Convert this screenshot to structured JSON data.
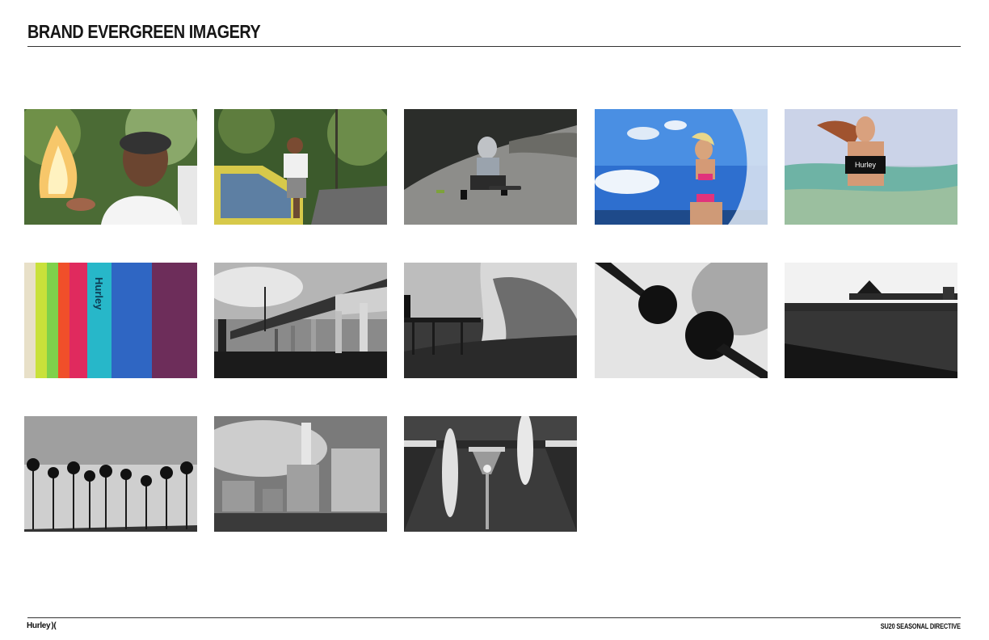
{
  "header": {
    "title": "BRAND EVERGREEN IMAGERY"
  },
  "footer": {
    "brand": "Hurley",
    "brand_mark_glyph": ")(",
    "right_text": "SU20 SEASONAL DIRECTIVE"
  },
  "gallery": {
    "photo_text": {
      "swimwear_logo": "Hurley",
      "board_logo": "Hurley"
    },
    "images": [
      {
        "name": "photo-man-fire-trees",
        "tone": "color"
      },
      {
        "name": "photo-man-sitting-car-forest",
        "tone": "color"
      },
      {
        "name": "photo-skater-sitting-hill",
        "tone": "color"
      },
      {
        "name": "photo-woman-water-splash",
        "tone": "color"
      },
      {
        "name": "photo-woman-ocean-swimwear",
        "tone": "color"
      },
      {
        "name": "photo-colorful-surfboards",
        "tone": "color"
      },
      {
        "name": "photo-pier-underside",
        "tone": "bw"
      },
      {
        "name": "photo-wave-pier",
        "tone": "bw"
      },
      {
        "name": "photo-palm-trees-sky",
        "tone": "bw"
      },
      {
        "name": "photo-crowd-pier",
        "tone": "bw"
      },
      {
        "name": "photo-palm-row-skyline",
        "tone": "bw"
      },
      {
        "name": "photo-power-plant",
        "tone": "bw"
      },
      {
        "name": "photo-surfboard-room",
        "tone": "bw"
      }
    ]
  }
}
